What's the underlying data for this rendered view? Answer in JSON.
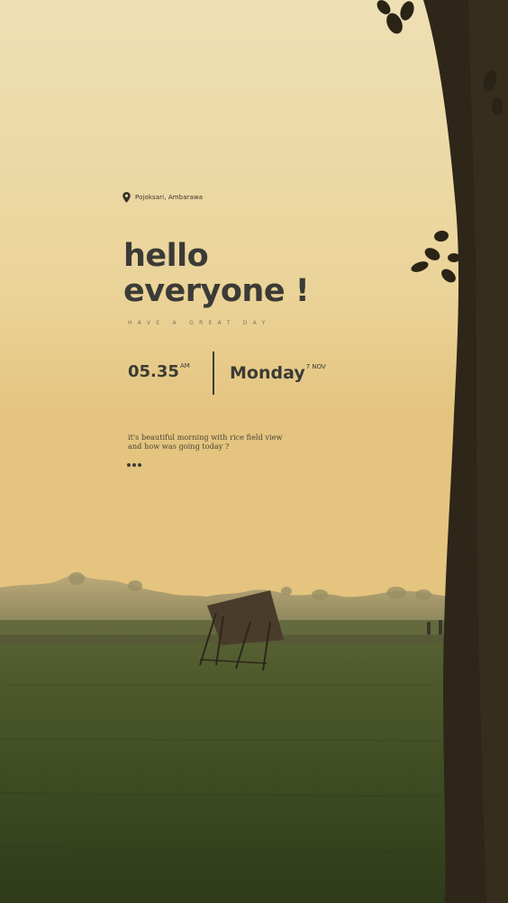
{
  "location": {
    "icon": "map-pin-icon",
    "text": "Pojoksari, Ambarawa"
  },
  "greeting": {
    "line1": "hello",
    "line2": "everyone !"
  },
  "tagline": "HAVE A GREAT DAY",
  "time": {
    "value": "05.35",
    "meridiem": "AM"
  },
  "date": {
    "day": "Monday",
    "date": "7 NOV"
  },
  "message": {
    "line1": "it's beautiful morning with rice field view",
    "line2": "and how was going today ?"
  },
  "more": {
    "icon": "more-dots-icon"
  },
  "colors": {
    "sky_top": "#efdcae",
    "sky_bottom": "#e4c784",
    "text_dark": "#3b3a36",
    "field": "#3b4a25"
  }
}
